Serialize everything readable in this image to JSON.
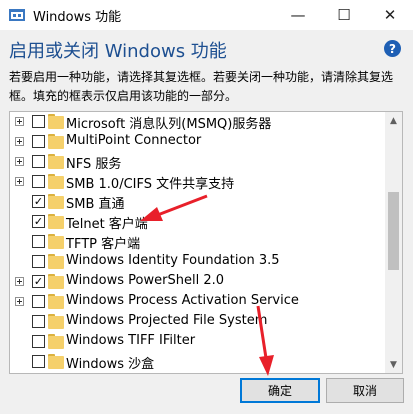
{
  "window": {
    "title": "Windows 功能",
    "minimize_label": "—",
    "maximize_label": "☐",
    "close_label": "✕"
  },
  "header": {
    "title": "启用或关闭 Windows 功能",
    "help_label": "?"
  },
  "description": "若要启用一种功能，请选择其复选框。若要关闭一种功能，请清除其复选框。填充的框表示仅启用该功能的一部分。",
  "features": [
    {
      "label": "Microsoft 消息队列(MSMQ)服务器",
      "expandable": true,
      "state": "unchecked"
    },
    {
      "label": "MultiPoint Connector",
      "expandable": true,
      "state": "unchecked"
    },
    {
      "label": "NFS 服务",
      "expandable": true,
      "state": "unchecked"
    },
    {
      "label": "SMB 1.0/CIFS 文件共享支持",
      "expandable": true,
      "state": "unchecked"
    },
    {
      "label": "SMB 直通",
      "expandable": false,
      "state": "checked"
    },
    {
      "label": "Telnet 客户端",
      "expandable": false,
      "state": "checked"
    },
    {
      "label": "TFTP 客户端",
      "expandable": false,
      "state": "unchecked"
    },
    {
      "label": "Windows Identity Foundation 3.5",
      "expandable": false,
      "state": "unchecked"
    },
    {
      "label": "Windows PowerShell 2.0",
      "expandable": true,
      "state": "checked"
    },
    {
      "label": "Windows Process Activation Service",
      "expandable": true,
      "state": "unchecked"
    },
    {
      "label": "Windows Projected File System",
      "expandable": false,
      "state": "unchecked"
    },
    {
      "label": "Windows TIFF IFilter",
      "expandable": false,
      "state": "unchecked"
    },
    {
      "label": "Windows 沙盒",
      "expandable": false,
      "state": "unchecked"
    }
  ],
  "scrollbar": {
    "up_label": "▲",
    "down_label": "▼"
  },
  "buttons": {
    "ok": "确定",
    "cancel": "取消"
  },
  "colors": {
    "accent": "#0078d7",
    "heading": "#1d4f91",
    "annotation": "#e8202a"
  }
}
